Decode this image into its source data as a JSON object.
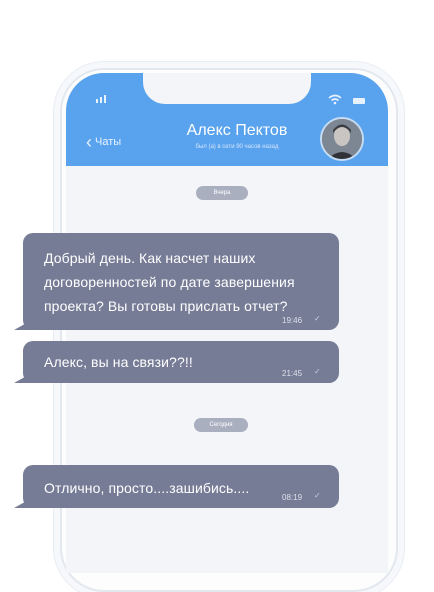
{
  "header": {
    "back_label": "Чаты",
    "contact_name": "Алекс Пектов",
    "status": "был (а) в сети 90 часов назад"
  },
  "dividers": {
    "yesterday": "Вчера",
    "today": "Сегодня"
  },
  "messages": [
    {
      "text": "Добрый день. Как насчет наших\nдоговоренностей по дате завершения\nпроекта? Вы готовы прислать отчет?",
      "time": "19:46"
    },
    {
      "text": "Алекс, вы на связи??!!",
      "time": "21:45"
    },
    {
      "text": "Отлично, просто....зашибись....",
      "time": "08:19"
    }
  ],
  "colors": {
    "header_bg": "#59a2ee",
    "bubble_bg": "#767c96",
    "pill_bg": "#a9afbf",
    "chat_bg": "#f4f5f8"
  },
  "icons": {
    "signal": "signal-bars-icon",
    "wifi": "wifi-icon",
    "battery": "battery-icon",
    "back": "chevron-left-icon",
    "read": "check-icon"
  }
}
